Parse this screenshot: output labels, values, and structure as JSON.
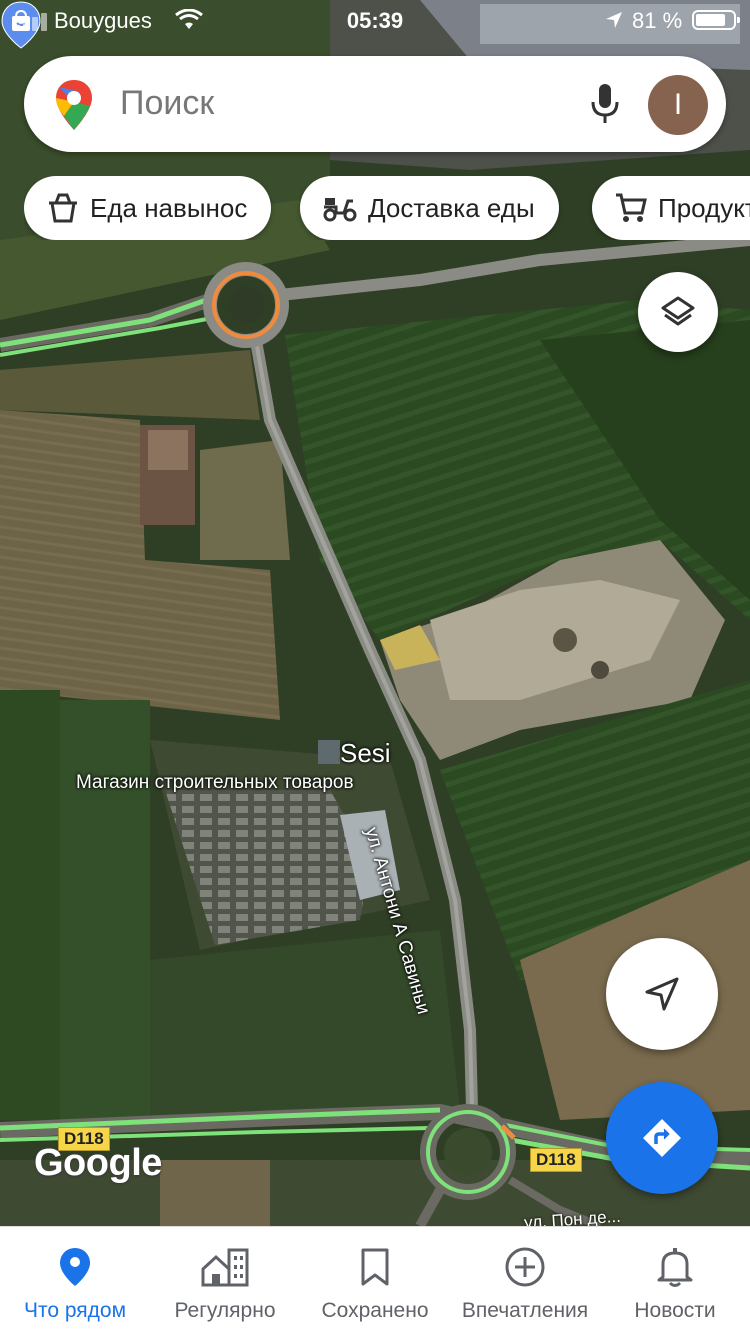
{
  "status_bar": {
    "carrier": "Bouygues",
    "time": "05:39",
    "battery": "81 %",
    "battery_level": 0.81
  },
  "search": {
    "placeholder": "Поиск",
    "avatar_letter": "I"
  },
  "chips": [
    {
      "label": "Еда навынос",
      "icon": "takeout-icon"
    },
    {
      "label": "Доставка еды",
      "icon": "delivery-scooter-icon"
    },
    {
      "label": "Продукты",
      "icon": "cart-icon"
    }
  ],
  "map": {
    "place_name": "Sesi",
    "place_category": "Магазин строительных товаров",
    "street": "ул. Антони А Савиньи",
    "road_labels": [
      "D118",
      "D118"
    ],
    "bottom_street": "ул. Пон де...",
    "logo": "Google"
  },
  "nav": [
    {
      "label": "Что рядом",
      "icon": "location-pin-icon",
      "active": true
    },
    {
      "label": "Регулярно",
      "icon": "commute-buildings-icon",
      "active": false
    },
    {
      "label": "Сохранено",
      "icon": "bookmark-icon",
      "active": false
    },
    {
      "label": "Впечатления",
      "icon": "add-circle-icon",
      "active": false
    },
    {
      "label": "Новости",
      "icon": "bell-icon",
      "active": false
    }
  ],
  "colors": {
    "accent": "#1a73e8",
    "traffic_green": "#7ee17a",
    "traffic_orange": "#f08a3c",
    "road_badge": "#f6d549"
  }
}
